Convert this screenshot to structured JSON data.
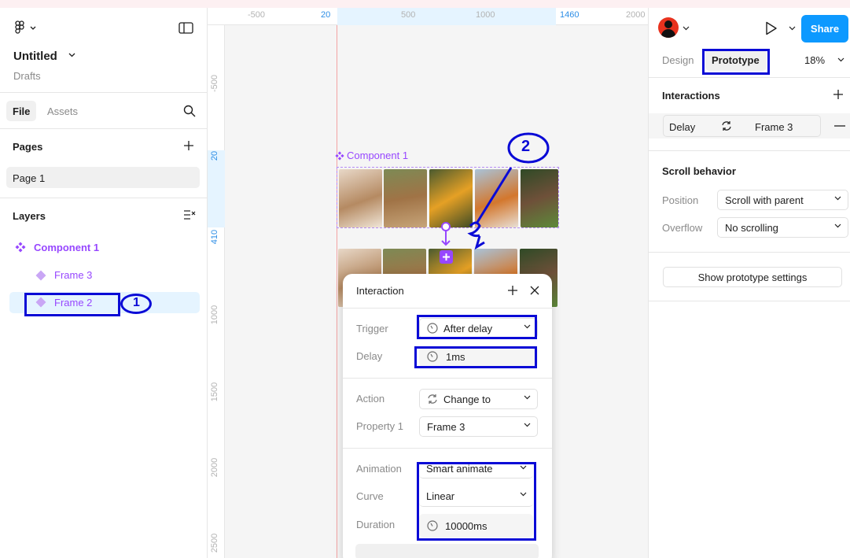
{
  "file": {
    "title": "Untitled",
    "location": "Drafts"
  },
  "left_tabs": {
    "file": "File",
    "assets": "Assets"
  },
  "pages": {
    "heading": "Pages",
    "items": [
      "Page 1"
    ]
  },
  "layers": {
    "heading": "Layers",
    "items": [
      "Component 1",
      "Frame 3",
      "Frame 2"
    ]
  },
  "ruler": {
    "top": [
      "-500",
      "20",
      "500",
      "1000",
      "1460",
      "2000"
    ],
    "left": [
      "-500",
      "20",
      "410",
      "1000",
      "1500",
      "2000",
      "2500"
    ]
  },
  "canvas": {
    "component_label": "Component 1"
  },
  "interaction": {
    "title": "Interaction",
    "trigger_label": "Trigger",
    "trigger_value": "After delay",
    "delay_label": "Delay",
    "delay_value": "1ms",
    "action_label": "Action",
    "action_value": "Change to",
    "property_label": "Property 1",
    "property_value": "Frame 3",
    "animation_label": "Animation",
    "animation_value": "Smart animate",
    "curve_label": "Curve",
    "curve_value": "Linear",
    "duration_label": "Duration",
    "duration_value": "10000ms"
  },
  "right": {
    "share": "Share",
    "tab_design": "Design",
    "tab_prototype": "Prototype",
    "zoom": "18%",
    "interactions_heading": "Interactions",
    "interaction_row": {
      "trigger": "Delay",
      "target": "Frame 3"
    },
    "scroll_heading": "Scroll behavior",
    "position_label": "Position",
    "position_value": "Scroll with parent",
    "overflow_label": "Overflow",
    "overflow_value": "No scrolling",
    "settings_button": "Show prototype settings"
  },
  "annotations": [
    "1",
    "2",
    "2"
  ],
  "colors": {
    "accent": "#0d99ff",
    "component": "#9747ff",
    "highlight": "#0a0ad6"
  }
}
